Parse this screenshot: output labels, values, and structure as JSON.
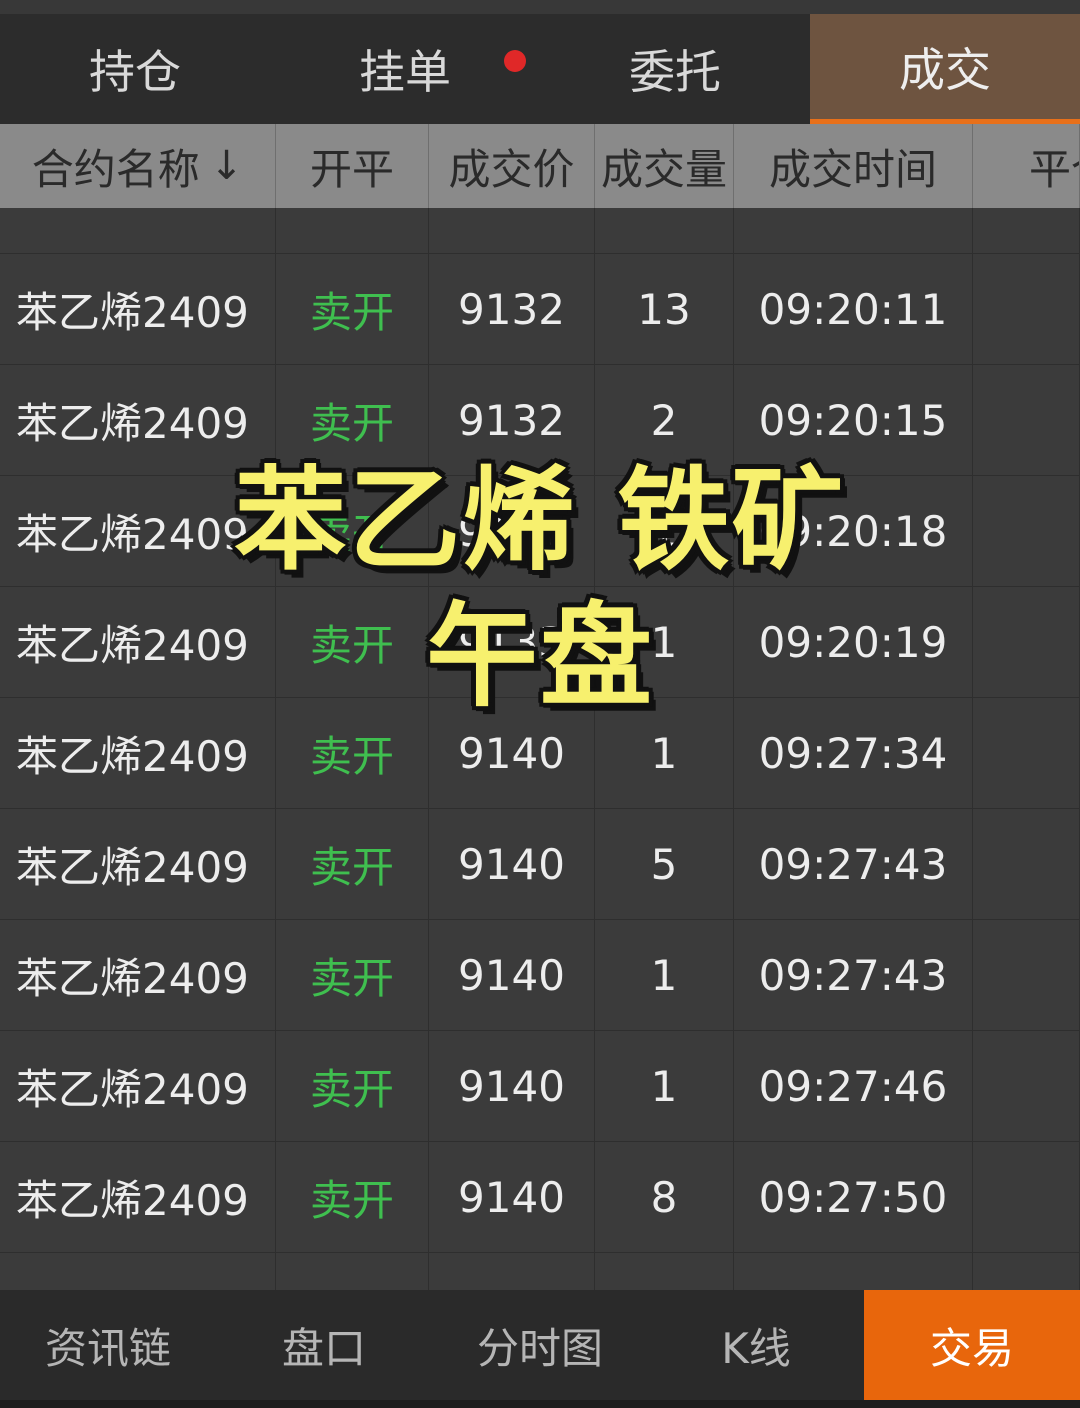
{
  "top_tabs": [
    {
      "label": "持仓",
      "active": false
    },
    {
      "label": "挂单",
      "active": false,
      "has_badge": true
    },
    {
      "label": "委托",
      "active": false
    },
    {
      "label": "成交",
      "active": true
    }
  ],
  "table": {
    "columns": [
      "合约名称",
      "开平",
      "成交价",
      "成交量",
      "成交时间",
      "平仓"
    ],
    "sort_arrow": "↓",
    "rows": [
      {
        "name": "苯乙烯2409",
        "side": "卖开",
        "price": "9132",
        "qty": "13",
        "time": "09:20:11"
      },
      {
        "name": "苯乙烯2409",
        "side": "卖开",
        "price": "9132",
        "qty": "2",
        "time": "09:20:15"
      },
      {
        "name": "苯乙烯2409",
        "side": "卖开",
        "price": "9132",
        "qty": "1",
        "time": "09:20:18"
      },
      {
        "name": "苯乙烯2409",
        "side": "卖开",
        "price": "9133",
        "qty": "1",
        "time": "09:20:19"
      },
      {
        "name": "苯乙烯2409",
        "side": "卖开",
        "price": "9140",
        "qty": "1",
        "time": "09:27:34"
      },
      {
        "name": "苯乙烯2409",
        "side": "卖开",
        "price": "9140",
        "qty": "5",
        "time": "09:27:43"
      },
      {
        "name": "苯乙烯2409",
        "side": "卖开",
        "price": "9140",
        "qty": "1",
        "time": "09:27:43"
      },
      {
        "name": "苯乙烯2409",
        "side": "卖开",
        "price": "9140",
        "qty": "1",
        "time": "09:27:46"
      },
      {
        "name": "苯乙烯2409",
        "side": "卖开",
        "price": "9140",
        "qty": "8",
        "time": "09:27:50"
      }
    ]
  },
  "overlay": {
    "line1": "苯乙烯 铁矿",
    "line2": "午盘"
  },
  "bottom_nav": [
    {
      "label": "资讯链",
      "active": false
    },
    {
      "label": "盘口",
      "active": false
    },
    {
      "label": "分时图",
      "active": false
    },
    {
      "label": "K线",
      "active": false
    },
    {
      "label": "交易",
      "active": true
    }
  ],
  "colors": {
    "active_tab_bg": "#6e5440",
    "accent": "#e8660c",
    "sell_green": "#3fbf4f",
    "overlay_yellow": "#f7f06e"
  }
}
